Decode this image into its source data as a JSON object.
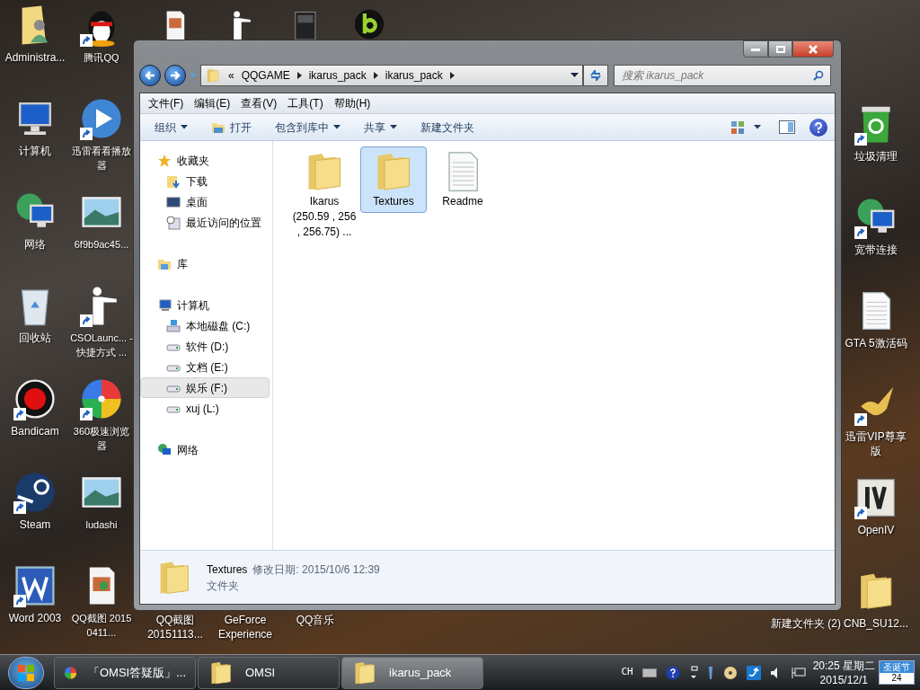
{
  "desktop": {
    "column_1": [
      {
        "label": "Administra...",
        "kind": "user-folder",
        "shortcut": false
      },
      {
        "label": "计算机",
        "kind": "computer",
        "shortcut": false
      },
      {
        "label": "网络",
        "kind": "network",
        "shortcut": false
      },
      {
        "label": "回收站",
        "kind": "recycle",
        "shortcut": false
      },
      {
        "label": "Bandicam",
        "kind": "record",
        "shortcut": true
      },
      {
        "label": "Steam",
        "kind": "steam",
        "shortcut": true
      },
      {
        "label": "Word 2003",
        "kind": "word",
        "shortcut": true
      }
    ],
    "column_2": [
      {
        "label": "腾讯QQ",
        "kind": "penguin",
        "shortcut": true
      },
      {
        "label": "迅雷看看播放器",
        "kind": "play",
        "shortcut": true
      },
      {
        "label": "6f9b9ac45...",
        "kind": "image",
        "shortcut": false
      },
      {
        "label": "CSOLaunc... - 快捷方式 ...",
        "kind": "soldier",
        "shortcut": true
      },
      {
        "label": "360极速浏览器",
        "kind": "pinwheel",
        "shortcut": true
      },
      {
        "label": "ludashi",
        "kind": "image",
        "shortcut": false
      },
      {
        "label": "QQ截图 20150411...",
        "kind": "picture-file",
        "shortcut": false
      }
    ],
    "bottom_row": [
      "QQ截图 20151113...",
      "GeForce Experience",
      "QQ音乐"
    ],
    "column_right": [
      {
        "label": "垃圾清理",
        "kind": "bin",
        "shortcut": true
      },
      {
        "label": "宽带连接",
        "kind": "network",
        "shortcut": true
      },
      {
        "label": "GTA 5激活码",
        "kind": "document",
        "shortcut": false
      },
      {
        "label": "迅雷VIP尊享版",
        "kind": "bird",
        "shortcut": true
      },
      {
        "label": "OpenIV",
        "kind": "openiv",
        "shortcut": true
      }
    ],
    "bottom_right": [
      {
        "label": "新建文件夹 (2)",
        "kind": "none",
        "shortcut": false
      },
      {
        "label": "CNB_SU12...",
        "kind": "folder",
        "shortcut": false
      }
    ]
  },
  "window": {
    "breadcrumb": [
      "«",
      "QQGAME",
      "ikarus_pack",
      "ikarus_pack"
    ],
    "search": {
      "placeholder": "搜索 ikarus_pack"
    },
    "menu": [
      "文件(F)",
      "编辑(E)",
      "查看(V)",
      "工具(T)",
      "帮助(H)"
    ],
    "toolbar": [
      {
        "label": "组织",
        "dropdown": true,
        "kind": "text"
      },
      {
        "label": "打开",
        "dropdown": false,
        "kind": "open"
      },
      {
        "label": "包含到库中",
        "dropdown": true,
        "kind": "text"
      },
      {
        "label": "共享",
        "dropdown": true,
        "kind": "text"
      },
      {
        "label": "新建文件夹",
        "dropdown": false,
        "kind": "text"
      }
    ],
    "nav": [
      {
        "label": "收藏夹",
        "kind": "star",
        "selected": false,
        "children": [
          {
            "label": "下载",
            "kind": "download",
            "selected": false
          },
          {
            "label": "桌面",
            "kind": "desktop",
            "selected": false
          },
          {
            "label": "最近访问的位置",
            "kind": "recent",
            "selected": false
          }
        ]
      },
      {
        "label": "库",
        "kind": "library",
        "selected": false
      },
      {
        "label": "计算机",
        "kind": "computer",
        "selected": false,
        "children": [
          {
            "label": "本地磁盘 (C:)",
            "kind": "system-drive",
            "selected": false
          },
          {
            "label": "软件 (D:)",
            "kind": "drive",
            "selected": false
          },
          {
            "label": "文档 (E:)",
            "kind": "drive",
            "selected": false
          },
          {
            "label": "娱乐 (F:)",
            "kind": "drive",
            "selected": true
          },
          {
            "label": "xuj (L:)",
            "kind": "drive",
            "selected": false
          }
        ]
      },
      {
        "label": "网络",
        "kind": "network",
        "selected": false
      }
    ],
    "files": [
      {
        "name": "Ikarus (250.59 , 256 , 256.75) ...",
        "kind": "folder",
        "selected": false
      },
      {
        "name": "Textures",
        "kind": "folder",
        "selected": true
      },
      {
        "name": "Readme",
        "kind": "document",
        "selected": false
      }
    ],
    "details": {
      "name": "Textures",
      "modified": "修改日期: 2015/10/6 12:39",
      "type": "文件夹"
    }
  },
  "taskbar": {
    "tasks": [
      {
        "label": "「OMSI答疑版」...",
        "kind": "pinwheel",
        "selected": false
      },
      {
        "label": "OMSI",
        "kind": "folder",
        "selected": false
      },
      {
        "label": "ikarus_pack",
        "kind": "folder",
        "selected": true
      }
    ],
    "ime": "CH",
    "time": "20:25 星期二",
    "date": "2015/12/1",
    "calendar": {
      "title": "圣诞节",
      "day": "24"
    }
  }
}
